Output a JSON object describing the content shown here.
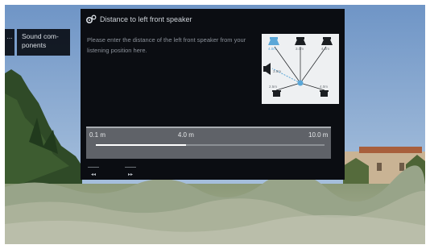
{
  "side_menu": {
    "dots_label": "...",
    "sound_components_label": "Sound com- ponents"
  },
  "dialog": {
    "title": "Distance to left front speaker",
    "instruction": "Please enter the distance of the left front speaker from your listening position here.",
    "diagram": {
      "speakers": [
        {
          "label": "4.0m",
          "highlight": true
        },
        {
          "label": "3.0m",
          "highlight": false
        },
        {
          "label": "4.0m",
          "highlight": false
        },
        {
          "label": "3.5m",
          "highlight": false
        },
        {
          "label": "2.5m",
          "highlight": false
        },
        {
          "label": "4.0m",
          "highlight": false
        }
      ]
    },
    "slider": {
      "min_label": "0.1 m",
      "value_label": "4.0 m",
      "max_label": "10.0 m",
      "min": 0.1,
      "value": 4.0,
      "max": 10.0
    },
    "nav": {
      "prev_glyph": "◂◂",
      "next_glyph": "▸▸"
    }
  },
  "colors": {
    "dialog_bg": "#0b0d12",
    "accent_blue": "#5aa7d8",
    "slider_bg": "#5f6268"
  }
}
